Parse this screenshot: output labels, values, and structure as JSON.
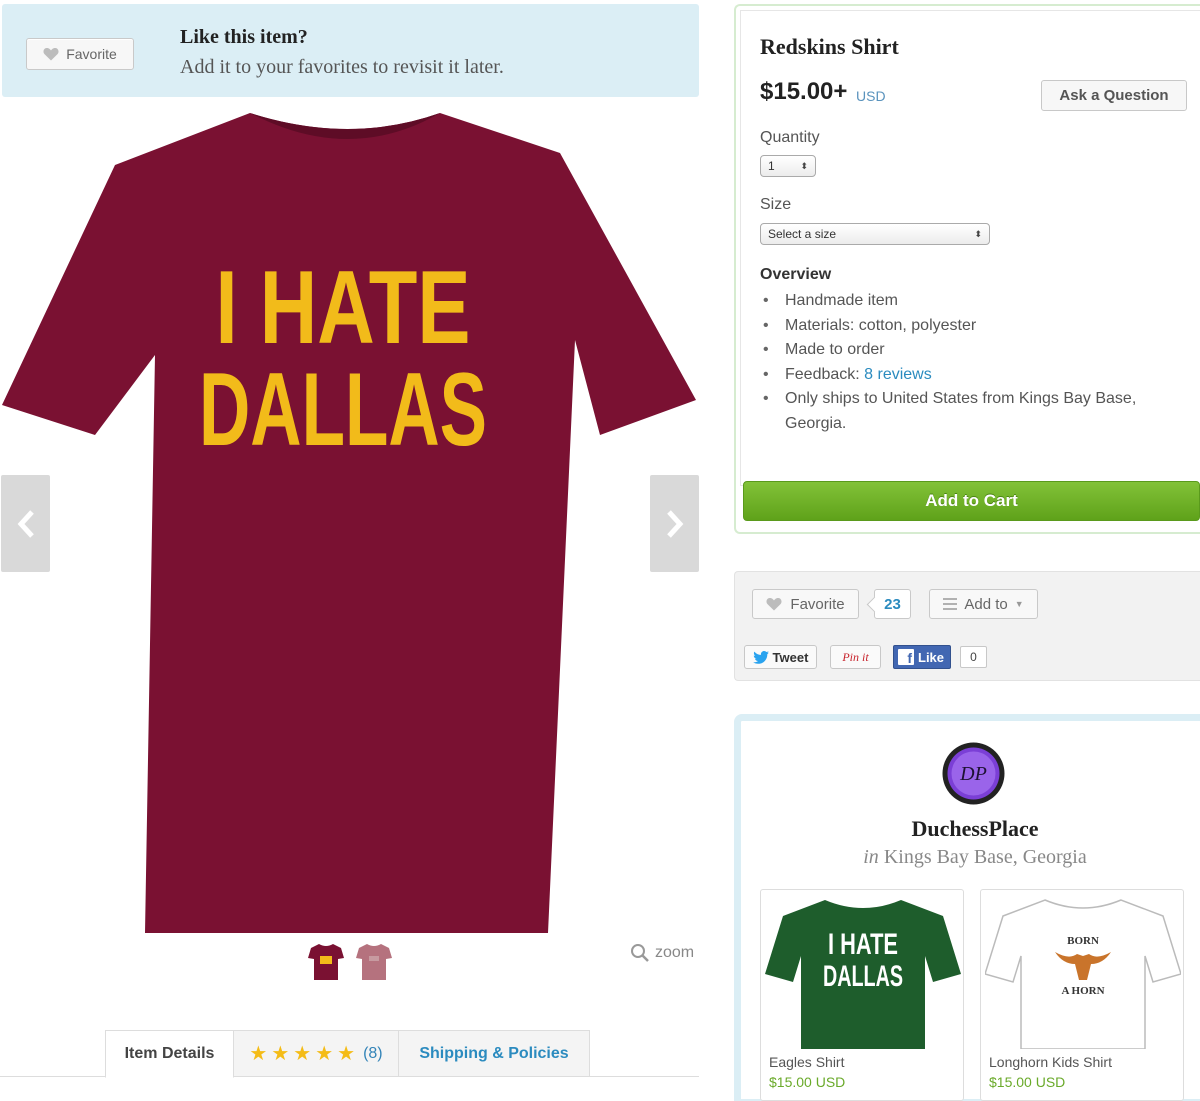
{
  "favorite_banner": {
    "button_label": "Favorite",
    "title": "Like this item?",
    "subtitle": "Add it to your favorites to revisit it later."
  },
  "product_image": {
    "shirt_color": "#7a1132",
    "text_color": "#f2bb1a",
    "line1": "I HATE",
    "line2": "DALLAS"
  },
  "gallery": {
    "zoom_label": "zoom",
    "thumbnails": [
      "maroon-shirt",
      "pink-shirt"
    ]
  },
  "tabs": {
    "details": "Item Details",
    "reviews_count": "(8)",
    "rating_stars": 5,
    "shipping": "Shipping & Policies"
  },
  "listing": {
    "title": "Redskins Shirt",
    "price": "$15.00+",
    "currency": "USD",
    "ask_button": "Ask a Question",
    "quantity_label": "Quantity",
    "quantity_value": "1",
    "size_label": "Size",
    "size_placeholder": "Select a size",
    "overview_heading": "Overview",
    "overview": {
      "item1": "Handmade item",
      "item2": "Materials: cotton, polyester",
      "item3": "Made to order",
      "item4_prefix": "Feedback: ",
      "item4_link": "8 reviews",
      "item5": "Only ships to United States from Kings Bay Base, Georgia."
    },
    "add_to_cart": "Add to Cart"
  },
  "social": {
    "favorite_label": "Favorite",
    "favorite_count": "23",
    "add_to_label": "Add to",
    "tweet_label": "Tweet",
    "pin_label": "Pin it",
    "like_label": "Like",
    "like_count": "0"
  },
  "shop": {
    "name": "DuchessPlace",
    "location_prefix": "in",
    "location": "Kings Bay Base, Georgia",
    "avatar_initials": "DP",
    "items": [
      {
        "name": "Eagles Shirt",
        "price": "$15.00 USD",
        "shirt_color": "#1e5d2c",
        "line1": "I HATE",
        "line2": "DALLAS"
      },
      {
        "name": "Longhorn Kids Shirt",
        "price": "$15.00 USD",
        "shirt_color": "#ffffff",
        "line1": "BORN",
        "line2": "A HORN"
      }
    ]
  },
  "colors": {
    "accent_blue": "#2b8bbf",
    "cart_green": "#6cb124",
    "banner_bg": "#dbeef5"
  }
}
